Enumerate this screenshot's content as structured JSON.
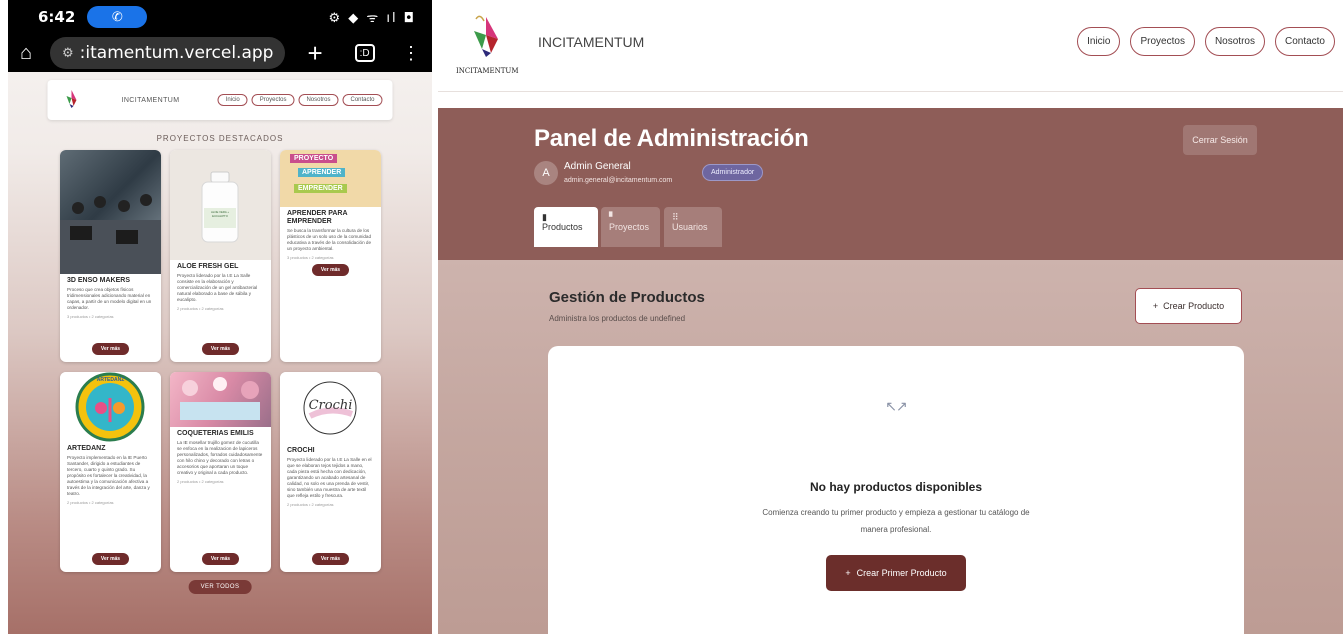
{
  "phone": {
    "status": {
      "time": "6:42",
      "call_icon": "phone-icon",
      "icons": "⚙ ◆ ᯤ ıl ◘"
    },
    "browser": {
      "home_icon": "home-icon",
      "url": ":itamentum.vercel.app",
      "tabs_count": ":D",
      "menu_icon": "more-vert-icon"
    },
    "nav": {
      "brand": "INCITAMENTUM",
      "logo_text": "INCITAMENTUM",
      "links": [
        "Inicio",
        "Proyectos",
        "Nosotros",
        "Contacto"
      ]
    },
    "section_title": "PROYECTOS DESTACADOS",
    "cards": [
      {
        "title": "3D ENSO MAKERS",
        "desc": "Proceso que crea objetos físicos tridimensionales adicionando material en capas, a partir de un modelo digital en un ordenador.",
        "meta": "3 productos • 2 categorías",
        "button": "Ver más"
      },
      {
        "title": "ALOE FRESH GEL",
        "desc": "Proyecto liderado por la I.E La Salle consiste en la elaboración y comercialización de un gel antibacterial natural elaborado a base de sábila y eucalipto.",
        "meta": "2 productos • 2 categorías",
        "button": "Ver más",
        "img_label": "ALOE VERA + EUCALIPTO"
      },
      {
        "title": "APRENDER PARA EMPRENDER",
        "desc": "Se busca la transformar la cultura de los plásticos de un solo uso de la comunidad educativa a través de la consolidación de un proyecto ambiental.",
        "meta": "3 productos • 2 categorías",
        "button": "Ver más",
        "img_lines": [
          "PROYECTO",
          "APRENDER",
          "EMPRENDER"
        ]
      },
      {
        "title": "ARTEDANZ",
        "desc": "Proyecto implementado en la IE Puerto Santander, dirigido a estudiantes de tercero, cuarto y quinto grado. Su propósito es fortalecer la creatividad, la autoestima y la comunicación afectiva a través de la integración del arte, danza y teatro.",
        "meta": "2 productos • 2 categorías",
        "button": "Ver más",
        "img_label": "ARTEDANZ"
      },
      {
        "title": "COQUETERIAS EMILIS",
        "desc": "La IE mosellar trujillo gomez de cucutilla se enfoca en la realizacion de lapiceros personalizados, forrados cuidadosamente con hilo chino y decorado con letras o accesorios que aportaran un toque creativo y original a cada producto.",
        "meta": "2 productos • 2 categorías",
        "button": "Ver más"
      },
      {
        "title": "CROCHI",
        "desc": "Proyecto liderado por la I.E La Salle en el que se elaboran tejos tejidos a mano, cada pieza está hecha con dedicación, garantizando un acabado artesanal de calidad, no solo es una prenda de vestir, sino también una muestra de arte textil que refleja estilo y frescura.",
        "meta": "2 productos • 2 categorías",
        "button": "Ver más",
        "img_label": "Crochi"
      }
    ],
    "view_all": "VER TODOS"
  },
  "desktop": {
    "nav": {
      "brand": "INCITAMENTUM",
      "logo_text": "INCITAMENTUM",
      "links": [
        "Inicio",
        "Proyectos",
        "Nosotros",
        "Contacto"
      ]
    },
    "panel": {
      "title": "Panel de Administración",
      "avatar_initial": "A",
      "user_name": "Admin General",
      "user_email": "admin.general@incitamentum.com",
      "role": "Administrador",
      "logout": "Cerrar Sesión"
    },
    "tabs": [
      {
        "label": "Productos",
        "icon": "bag-icon",
        "glyph": "🔒",
        "active": true
      },
      {
        "label": "Proyectos",
        "icon": "folder-icon",
        "glyph": "▆",
        "active": false
      },
      {
        "label": "Usuarios",
        "icon": "users-icon",
        "glyph": "⠿",
        "active": false
      }
    ],
    "products": {
      "title": "Gestión de Productos",
      "subtitle": "Administra los productos de undefined",
      "create_label": "Crear Producto",
      "plus": "+",
      "empty_icon": "↖↗",
      "empty_title": "No hay productos disponibles",
      "empty_desc": "Comienza creando tu primer producto y empieza a gestionar tu catálogo de manera profesional.",
      "first_label": "Crear Primer Producto"
    }
  },
  "colors": {
    "brand": "#6f2b2b",
    "band": "#8e5d58",
    "outline": "#a34e54",
    "role_badge": "#6e66a0"
  }
}
